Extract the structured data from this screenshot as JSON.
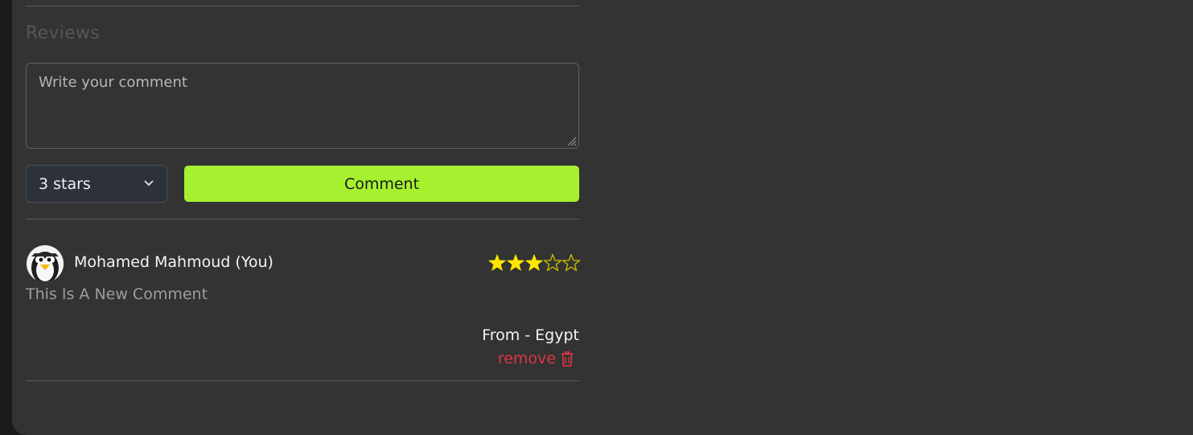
{
  "reviews": {
    "title": "Reviews",
    "comment_placeholder": "Write your comment",
    "rating_select": {
      "selected": "3 stars"
    },
    "comment_button": "Comment",
    "accent_color": "#a6f12f",
    "danger_color": "#dc3545",
    "items": [
      {
        "author": "Mohamed Mahmoud (You)",
        "rating": 3,
        "max_rating": 5,
        "text": "This Is A New Comment",
        "location": "From - Egypt",
        "remove_label": "remove",
        "avatar_icon": "penguin-avatar-icon"
      }
    ]
  }
}
